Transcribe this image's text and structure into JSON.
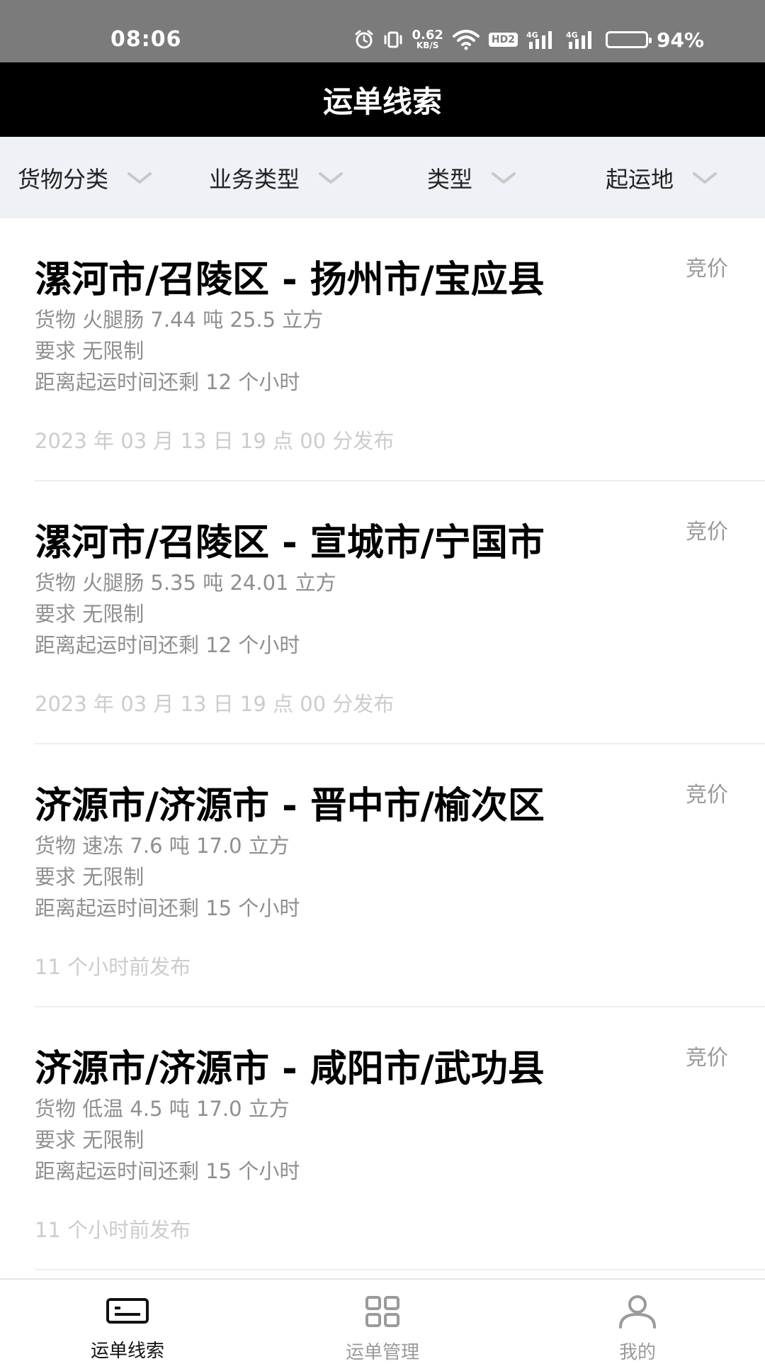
{
  "status_bar": {
    "time": "08:06",
    "net_speed_value": "0.62",
    "net_speed_unit": "KB/S",
    "hd_label": "HD2",
    "signal1_label": "4G",
    "signal2_label": "4G",
    "battery_percent_label": "94%",
    "battery_level": 0.94,
    "icons": [
      "alarm-icon",
      "vibrate-icon",
      "wifi-icon",
      "signal-icon",
      "battery-icon"
    ]
  },
  "header": {
    "title": "运单线索"
  },
  "filters": [
    {
      "label": "货物分类"
    },
    {
      "label": "业务类型"
    },
    {
      "label": "类型"
    },
    {
      "label": "起运地"
    }
  ],
  "orders": [
    {
      "route": "漯河市/召陵区 - 扬州市/宝应县",
      "tag": "竞价",
      "cargo": "货物 火腿肠 7.44 吨 25.5 立方",
      "requirement": "要求 无限制",
      "countdown": "距离起运时间还剩 12 个小时",
      "published": "2023 年 03 月 13 日 19 点 00 分发布"
    },
    {
      "route": "漯河市/召陵区 - 宣城市/宁国市",
      "tag": "竞价",
      "cargo": "货物 火腿肠 5.35 吨 24.01 立方",
      "requirement": "要求 无限制",
      "countdown": "距离起运时间还剩 12 个小时",
      "published": "2023 年 03 月 13 日 19 点 00 分发布"
    },
    {
      "route": "济源市/济源市 - 晋中市/榆次区",
      "tag": "竞价",
      "cargo": "货物 速冻 7.6 吨 17.0 立方",
      "requirement": "要求 无限制",
      "countdown": "距离起运时间还剩 15 个小时",
      "published": "11 个小时前发布"
    },
    {
      "route": "济源市/济源市 - 咸阳市/武功县",
      "tag": "竞价",
      "cargo": "货物 低温 4.5 吨 17.0 立方",
      "requirement": "要求 无限制",
      "countdown": "距离起运时间还剩 15 个小时",
      "published": "11 个小时前发布"
    }
  ],
  "bottom_nav": [
    {
      "label": "运单线索",
      "icon": "waybill-clue-icon",
      "active": true
    },
    {
      "label": "运单管理",
      "icon": "grid-icon",
      "active": false
    },
    {
      "label": "我的",
      "icon": "person-icon",
      "active": false
    }
  ],
  "colors": {
    "status_bar_bg": "#7b7b7b",
    "title_bar_bg": "#000000",
    "filter_bar_bg": "#eef1f5",
    "secondary_text": "#8f8f8f",
    "timestamp_text": "#cccccc"
  }
}
